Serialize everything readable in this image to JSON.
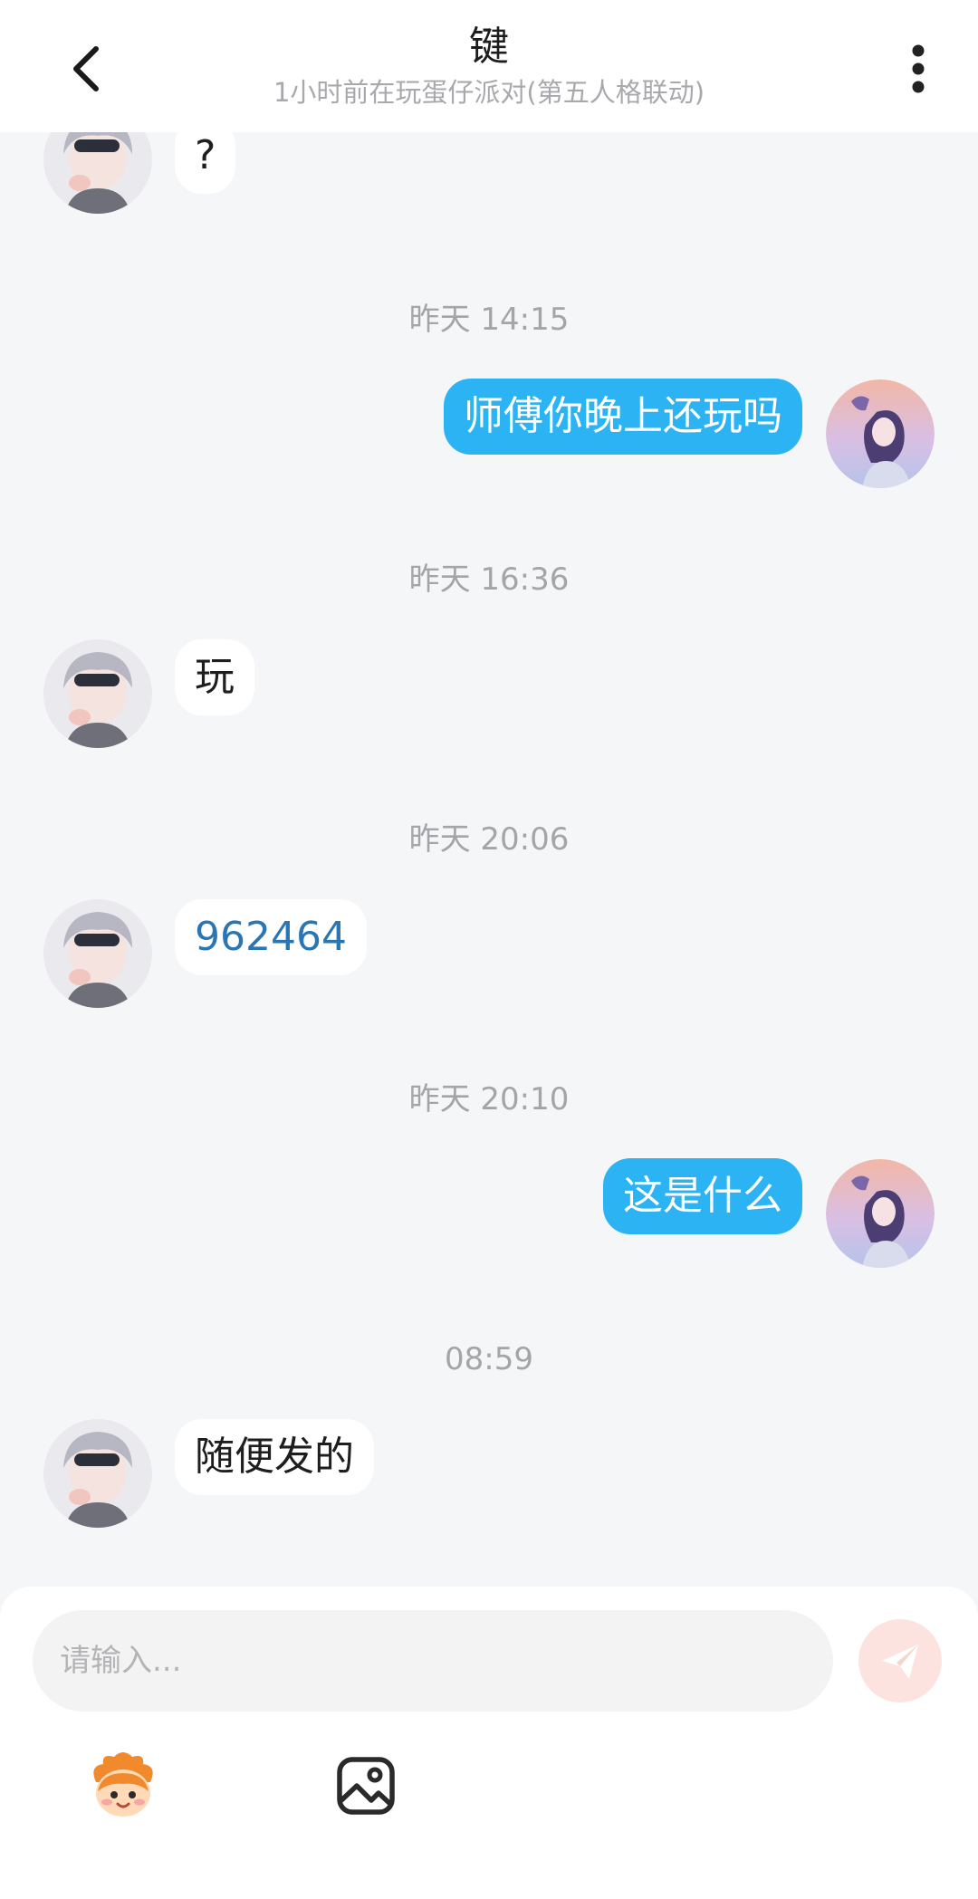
{
  "header": {
    "title": "键",
    "subtitle": "1小时前在玩蛋仔派对(第五人格联动)",
    "back_icon": "chevron-left-icon",
    "more_icon": "more-vertical-icon"
  },
  "messages": [
    {
      "type": "in",
      "text": "?"
    },
    {
      "type": "time",
      "text": "昨天 14:15"
    },
    {
      "type": "out",
      "text": "师傅你晚上还玩吗"
    },
    {
      "type": "time",
      "text": "昨天 16:36"
    },
    {
      "type": "in",
      "text": "玩"
    },
    {
      "type": "time",
      "text": "昨天 20:06"
    },
    {
      "type": "in",
      "text": "962464"
    },
    {
      "type": "time",
      "text": "昨天 20:10"
    },
    {
      "type": "out",
      "text": "这是什么"
    },
    {
      "type": "time",
      "text": "08:59"
    },
    {
      "type": "in",
      "text": "随便发的"
    }
  ],
  "composer": {
    "placeholder": "请输入...",
    "send_icon": "paper-plane-icon",
    "emoji_icon": "mascot-emoji-icon",
    "image_icon": "image-icon"
  },
  "colors": {
    "outgoing_bubble": "#2bb3f4",
    "incoming_bubble": "#ffffff",
    "background": "#f5f6f8",
    "link_text": "#2a75b3",
    "send_button": "#fde3e0"
  }
}
